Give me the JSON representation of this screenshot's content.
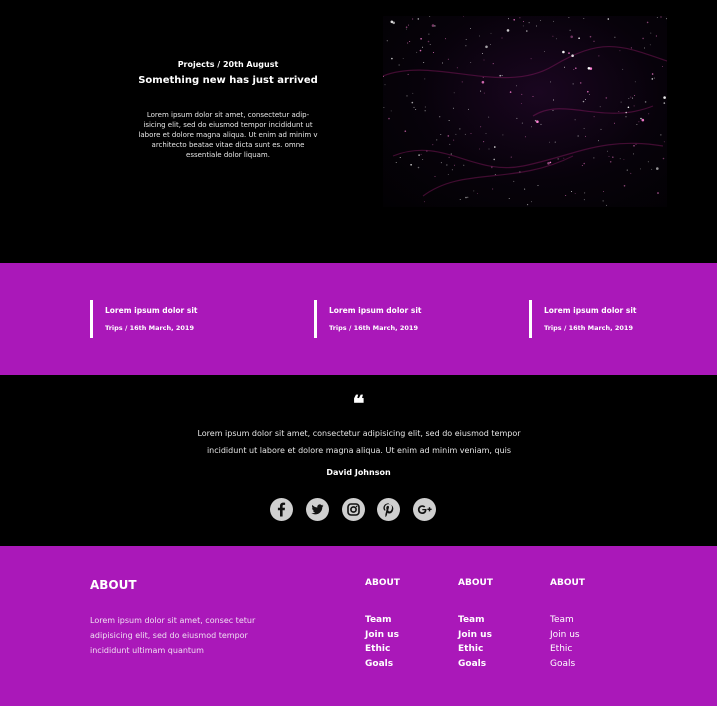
{
  "hero": {
    "meta": "Projects / 20th August",
    "title": "Something new has just arrived",
    "body": "Lorem ipsum dolor sit amet, consectetur adip-isicing elit, sed do eiusmod tempor incididunt ut labore et dolore magna aliqua. Ut enim ad minim v architecto beatae vitae dicta sunt es. omne essentiale dolor liquam."
  },
  "band": {
    "items": [
      {
        "title": "Lorem ipsum dolor sit",
        "date": "Trips / 16th March, 2019"
      },
      {
        "title": "Lorem ipsum dolor sit",
        "date": "Trips / 16th March, 2019"
      },
      {
        "title": "Lorem ipsum dolor sit",
        "date": "Trips / 16th March, 2019"
      }
    ]
  },
  "testimonial": {
    "mark": "❝",
    "text": "Lorem ipsum dolor sit amet, consectetur adipisicing elit, sed do eiusmod tempor incididunt ut labore et dolore magna aliqua. Ut enim ad minim veniam, quis",
    "author": "David Johnson",
    "socials": [
      "facebook-icon",
      "twitter-icon",
      "instagram-icon",
      "pinterest-icon",
      "google-plus-icon"
    ]
  },
  "footer": {
    "about_title": "ABOUT",
    "about_text": "Lorem ipsum dolor sit amet, consec tetur adipisicing elit, sed do eiusmod tempor incididunt ultimam quantum",
    "columns": [
      {
        "title": "ABOUT",
        "links": [
          "Team",
          "Join us",
          "Ethic",
          "Goals"
        ]
      },
      {
        "title": "ABOUT",
        "links": [
          "Team",
          "Join us",
          "Ethic",
          "Goals"
        ]
      },
      {
        "title": "ABOUT",
        "links": [
          "Team",
          "Join us",
          "Ethic",
          "Goals"
        ]
      }
    ]
  },
  "colors": {
    "accent": "#aa18b9",
    "background": "#000000",
    "icon_bg": "#cfcfcf"
  }
}
